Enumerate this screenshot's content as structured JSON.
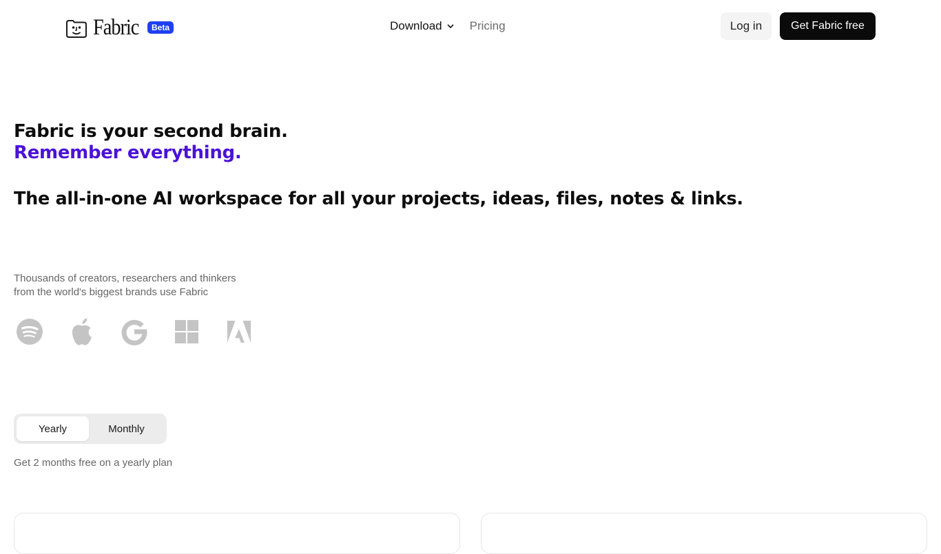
{
  "header": {
    "brand_name": "Fabric",
    "badge": "Beta",
    "nav": {
      "download_label": "Download",
      "pricing_label": "Pricing"
    },
    "login_label": "Log in",
    "cta_label": "Get Fabric free"
  },
  "hero": {
    "line1": "Fabric is your second brain.",
    "line2": "Remember everything.",
    "subheadline": "The all-in-one AI workspace for all your projects, ideas, files, notes & links."
  },
  "social_proof": {
    "line1": "Thousands of creators, researchers and thinkers",
    "line2": "from the world's biggest brands use Fabric",
    "brands": [
      "spotify-icon",
      "apple-icon",
      "google-icon",
      "windows-icon",
      "adobe-icon"
    ]
  },
  "billing": {
    "options": [
      "Yearly",
      "Monthly"
    ],
    "selected": "Yearly",
    "note": "Get 2 months free on a yearly plan"
  },
  "colors": {
    "accent_purple": "#4b12d6",
    "badge_blue": "#1e40f0",
    "cta_black": "#0b0b0b",
    "brand_logo_gray": "#c4c4c4"
  }
}
